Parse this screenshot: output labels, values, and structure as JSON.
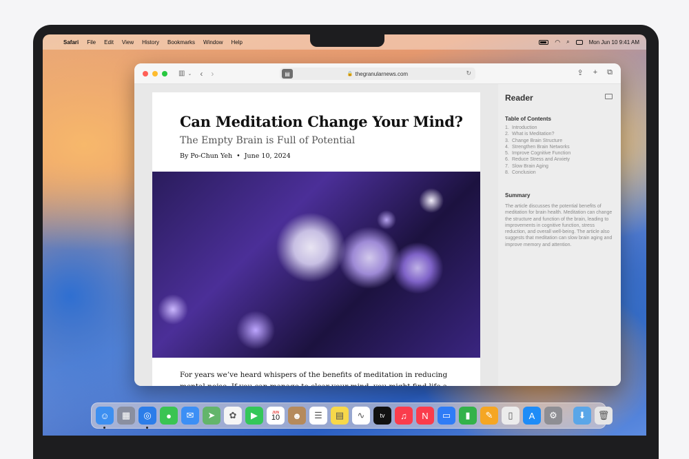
{
  "menubar": {
    "apple": "",
    "items": [
      "Safari",
      "File",
      "Edit",
      "View",
      "History",
      "Bookmarks",
      "Window",
      "Help"
    ],
    "datetime": "Mon Jun 10  9:41 AM"
  },
  "toolbar": {
    "url": "thegranularnews.com"
  },
  "article": {
    "title": "Can Meditation Change Your Mind?",
    "subtitle": "The Empty Brain is Full of Potential",
    "author": "By Po-Chun Yeh",
    "date": "June 10, 2024",
    "body": "For years we’ve heard whispers of the benefits of meditation in reducing mental noise. If you can manage to clear your mind, you might find life a little bit lighter"
  },
  "reader": {
    "title": "Reader",
    "toc_heading": "Table of Contents",
    "toc": [
      {
        "n": "1.",
        "label": "Introduction"
      },
      {
        "n": "2.",
        "label": "What is Meditation?"
      },
      {
        "n": "3.",
        "label": "Change Brain Structure"
      },
      {
        "n": "4.",
        "label": "Strengthen Brain Networks"
      },
      {
        "n": "5.",
        "label": "Improve Cognitive Function"
      },
      {
        "n": "6.",
        "label": "Reduce Stress and Anxiety"
      },
      {
        "n": "7.",
        "label": "Slow Brain Aging"
      },
      {
        "n": "8.",
        "label": "Conclusion"
      }
    ],
    "summary_heading": "Summary",
    "summary": "The article discusses the potential benefits of meditation for brain health. Meditation can change the structure and function of the brain, leading to improvements in cognitive function, stress reduction, and overall well-being. The article also suggests that meditation can slow brain aging and improve memory and attention."
  },
  "dock": {
    "calendar_month": "JUN",
    "calendar_day": "10",
    "tv_label": "tv",
    "apps": [
      {
        "name": "finder-icon",
        "color": "#3d8ff0",
        "glyph": "☺"
      },
      {
        "name": "launchpad-icon",
        "color": "#8a8fa0",
        "glyph": "▦"
      },
      {
        "name": "safari-icon",
        "color": "#2b7de9",
        "glyph": "◎"
      },
      {
        "name": "messages-icon",
        "color": "#3ac452",
        "glyph": "●"
      },
      {
        "name": "mail-icon",
        "color": "#3c8ff5",
        "glyph": "✉"
      },
      {
        "name": "maps-icon",
        "color": "#63b56b",
        "glyph": "➤"
      },
      {
        "name": "photos-icon",
        "color": "#f5f5f5",
        "glyph": "✿"
      },
      {
        "name": "facetime-icon",
        "color": "#34c759",
        "glyph": "▶"
      },
      {
        "name": "calendar-icon",
        "color": "#ffffff",
        "glyph": ""
      },
      {
        "name": "contacts-icon",
        "color": "#b58a5c",
        "glyph": "☻"
      },
      {
        "name": "reminders-icon",
        "color": "#ffffff",
        "glyph": "☰"
      },
      {
        "name": "notes-icon",
        "color": "#f7d84a",
        "glyph": "▤"
      },
      {
        "name": "freeform-icon",
        "color": "#ffffff",
        "glyph": "∿"
      },
      {
        "name": "tv-icon",
        "color": "#111111",
        "glyph": ""
      },
      {
        "name": "music-icon",
        "color": "#fa3c4c",
        "glyph": "♫"
      },
      {
        "name": "news-icon",
        "color": "#fa3c4c",
        "glyph": "N"
      },
      {
        "name": "keynote-icon",
        "color": "#2f7cf6",
        "glyph": "▭"
      },
      {
        "name": "numbers-icon",
        "color": "#33b24a",
        "glyph": "▮"
      },
      {
        "name": "pages-icon",
        "color": "#f5a623",
        "glyph": "✎"
      },
      {
        "name": "iphone-mirroring-icon",
        "color": "#ececec",
        "glyph": "▯"
      },
      {
        "name": "app-store-icon",
        "color": "#1e8cf7",
        "glyph": "A"
      },
      {
        "name": "system-settings-icon",
        "color": "#8e8e93",
        "glyph": "⚙"
      }
    ],
    "trailing": [
      {
        "name": "downloads-folder-icon",
        "color": "#5aa6e8",
        "glyph": "⬇"
      },
      {
        "name": "trash-icon",
        "color": "#e6e6e6",
        "glyph": "🗑"
      }
    ]
  }
}
